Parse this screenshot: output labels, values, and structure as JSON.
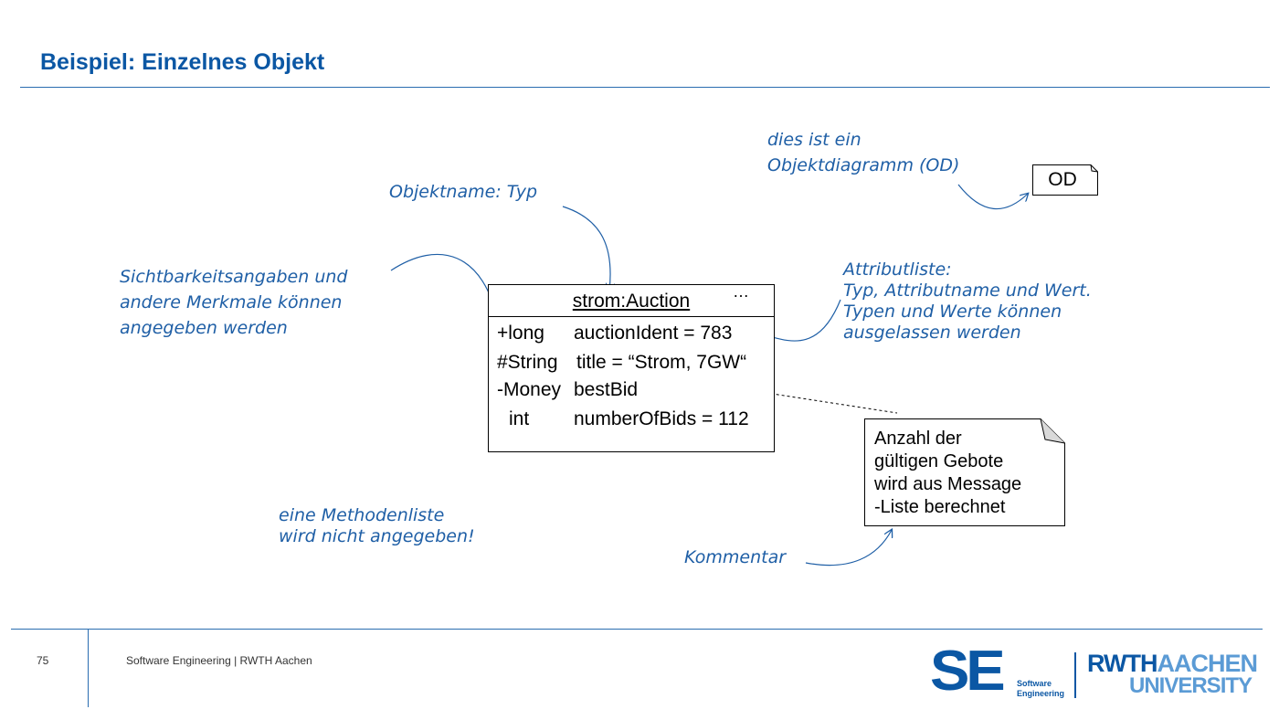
{
  "slide": {
    "title": "Beispiel: Einzelnes Objekt",
    "page_number": "75",
    "footer": "Software Engineering  |  RWTH Aachen"
  },
  "annotations": {
    "objektname": "Objektname: Typ",
    "sichtbarkeit": [
      "Sichtbarkeitsangaben und",
      "andere Merkmale können",
      "angegeben werden"
    ],
    "od_hint": [
      "dies ist ein",
      "Objektdiagramm (OD)"
    ],
    "attributliste": [
      "Attributliste:",
      "Typ, Attributname und Wert.",
      "Typen und Werte können",
      "ausgelassen werden"
    ],
    "methodenliste": [
      "eine Methodenliste",
      "wird nicht angegeben!"
    ],
    "kommentar": "Kommentar"
  },
  "object": {
    "name": "strom:Auction",
    "ellipsis": "…",
    "attributes": [
      {
        "modifier": "+long",
        "declaration": "auctionIdent = 783"
      },
      {
        "modifier": "#String",
        "declaration": "title = “Strom, 7GW“"
      },
      {
        "modifier": "-Money",
        "declaration": "bestBid"
      },
      {
        "modifier": "int",
        "declaration": "numberOfBids = 112"
      }
    ]
  },
  "comment": {
    "lines": [
      "Anzahl der",
      "gültigen  Gebote",
      "wird aus Message",
      "-Liste  berechnet"
    ]
  },
  "od_tag": "OD",
  "logos": {
    "se_letters": "SE",
    "se_sub": [
      "Software",
      "Engineering"
    ],
    "rwth_top": [
      "RWTH",
      "AACHEN"
    ],
    "rwth_bottom": "UNIVERSITY",
    "colors": {
      "brand_blue": "#0b57a4",
      "light_blue": "#5b9bd5",
      "annotation_blue": "#1f5fa6",
      "rule_blue": "#2a6db0"
    }
  }
}
